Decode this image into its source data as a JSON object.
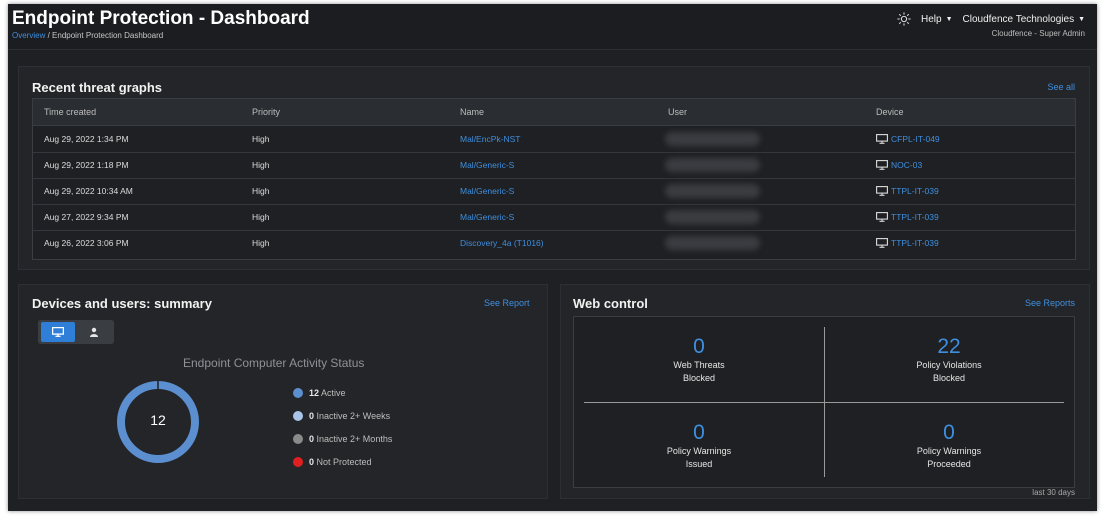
{
  "header": {
    "title": "Endpoint Protection - Dashboard",
    "breadcrumb": {
      "link": "Overview",
      "separator": "/",
      "current": "Endpoint Protection Dashboard"
    },
    "help_label": "Help",
    "org_label": "Cloudfence Technologies",
    "role_label": "Cloudfence - Super Admin"
  },
  "threats": {
    "title": "Recent threat graphs",
    "see_all": "See all",
    "columns": [
      "Time created",
      "Priority",
      "Name",
      "User",
      "Device"
    ],
    "rows": [
      {
        "time": "Aug 29, 2022 1:34 PM",
        "priority": "High",
        "name": "Mal/EncPk-NST",
        "device": "CFPL-IT-049"
      },
      {
        "time": "Aug 29, 2022 1:18 PM",
        "priority": "High",
        "name": "Mal/Generic-S",
        "device": "NOC-03"
      },
      {
        "time": "Aug 29, 2022 10:34 AM",
        "priority": "High",
        "name": "Mal/Generic-S",
        "device": "TTPL-IT-039"
      },
      {
        "time": "Aug 27, 2022 9:34 PM",
        "priority": "High",
        "name": "Mal/Generic-S",
        "device": "TTPL-IT-039"
      },
      {
        "time": "Aug 26, 2022 3:06 PM",
        "priority": "High",
        "name": "Discovery_4a (T1016)",
        "device": "TTPL-IT-039"
      }
    ]
  },
  "devices": {
    "title": "Devices and users: summary",
    "see_report": "See Report",
    "chart_title": "Endpoint Computer Activity Status",
    "total": "12",
    "legend": [
      {
        "count": "12",
        "label": "Active",
        "color": "#5b8fd0"
      },
      {
        "count": "0",
        "label": "Inactive 2+ Weeks",
        "color": "#a9c4e6"
      },
      {
        "count": "0",
        "label": "Inactive 2+ Months",
        "color": "#8a8a8a"
      },
      {
        "count": "0",
        "label": "Not Protected",
        "color": "#e02020"
      }
    ]
  },
  "web_control": {
    "title": "Web control",
    "see_reports": "See Reports",
    "cells": [
      {
        "value": "0",
        "line1": "Web Threats",
        "line2": "Blocked"
      },
      {
        "value": "22",
        "line1": "Policy Violations",
        "line2": "Blocked"
      },
      {
        "value": "0",
        "line1": "Policy Warnings",
        "line2": "Issued"
      },
      {
        "value": "0",
        "line1": "Policy Warnings",
        "line2": "Proceeded"
      }
    ],
    "footnote": "last 30 days"
  },
  "colors": {
    "accent": "#3f8fe0",
    "background": "#1e2023",
    "panel": "#232528"
  }
}
